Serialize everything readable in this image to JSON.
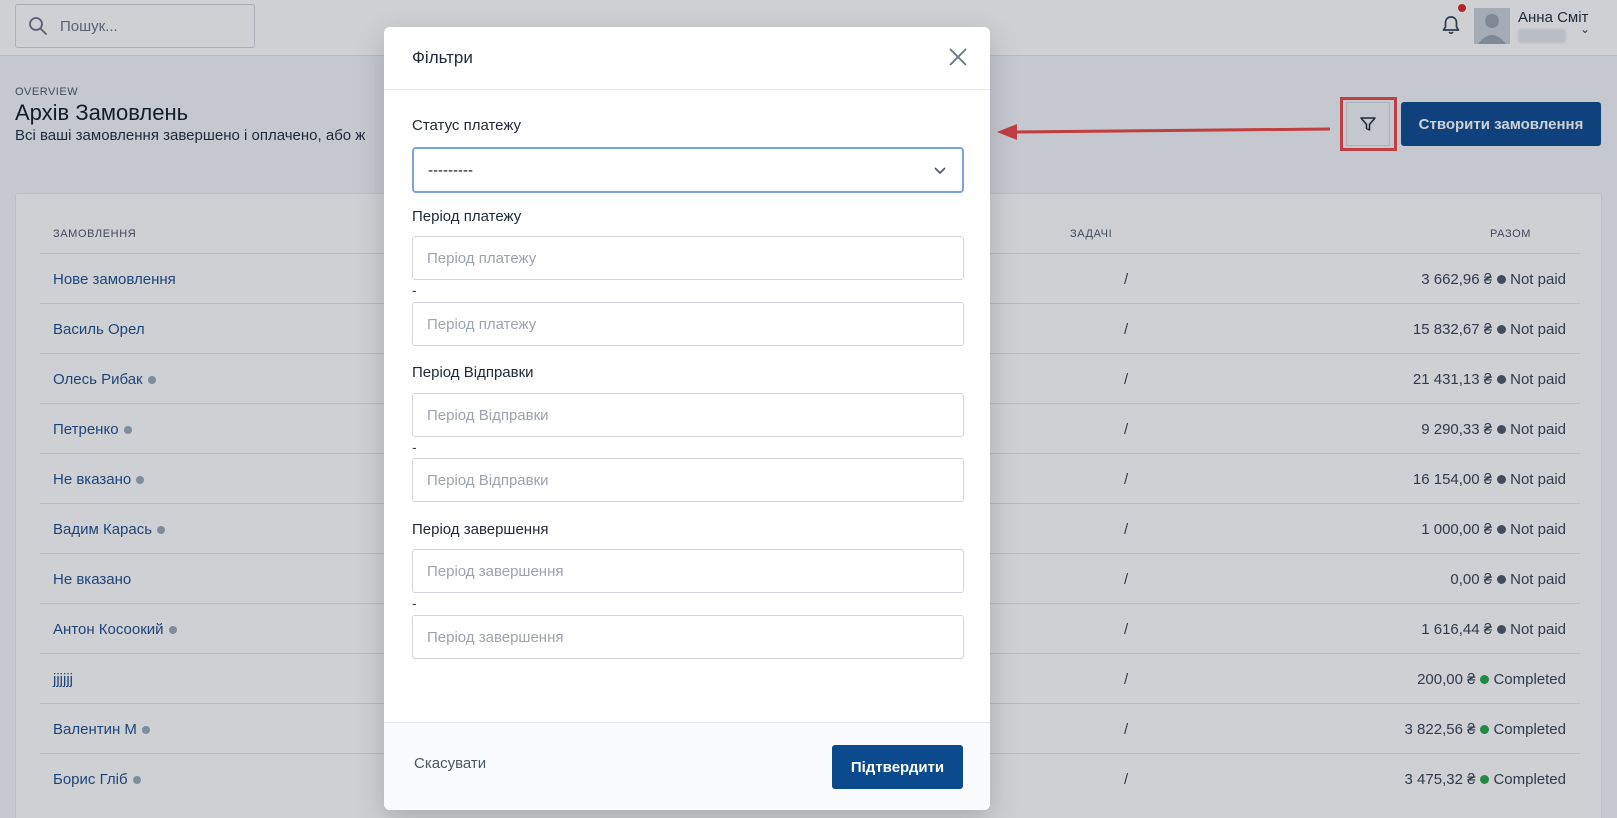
{
  "header": {
    "search_placeholder": "Пошук...",
    "user_name": "Анна Сміт"
  },
  "page": {
    "overline": "OVERVIEW",
    "title": "Архів Замовлень",
    "description": "Всі ваші замовлення завершено і оплачено, або ж",
    "create_button": "Створити замовлення"
  },
  "table": {
    "headers": {
      "orders": "ЗАМОВЛЕННЯ",
      "tasks": "ЗАДАЧІ",
      "total": "РАЗОМ"
    },
    "rows": [
      {
        "name": "Нове замовлення",
        "tasks": "/",
        "amount": "3 662,96 ₴",
        "status": "Not paid"
      },
      {
        "name": "Василь Орел",
        "tasks": "/",
        "amount": "15 832,67 ₴",
        "status": "Not paid"
      },
      {
        "name": "Олесь Рибак",
        "tasks": "/",
        "amount": "21 431,13 ₴",
        "status": "Not paid"
      },
      {
        "name": "Петренко",
        "tasks": "/",
        "amount": "9 290,33 ₴",
        "status": "Not paid"
      },
      {
        "name": "Не вказано",
        "tasks": "/",
        "amount": "16 154,00 ₴",
        "status": "Not paid"
      },
      {
        "name": "Вадим Карась",
        "tasks": "/",
        "amount": "1 000,00 ₴",
        "status": "Not paid"
      },
      {
        "name": "Не вказано",
        "tasks": "/",
        "amount": "0,00 ₴",
        "status": "Not paid"
      },
      {
        "name": "Антон Косоокий",
        "tasks": "/",
        "amount": "1 616,44 ₴",
        "status": "Not paid"
      },
      {
        "name": "jjjjjj",
        "tasks": "/",
        "amount": "200,00 ₴",
        "status": "Completed"
      },
      {
        "name": "Валентин М",
        "tasks": "/",
        "amount": "3 822,56 ₴",
        "status": "Completed"
      },
      {
        "name": "Борис Гліб",
        "tasks": "/",
        "amount": "3 475,32 ₴",
        "status": "Completed"
      }
    ]
  },
  "modal": {
    "title": "Фільтри",
    "payment_status_label": "Статус платежу",
    "payment_status_value": "---------",
    "payment_period_label": "Період платежу",
    "payment_period_placeholder": "Період платежу",
    "shipping_period_label": "Період Відправки",
    "shipping_period_placeholder": "Період Відправки",
    "completion_period_label": "Період завершення",
    "completion_period_placeholder": "Період завершення",
    "range_separator": "-",
    "cancel_label": "Скасувати",
    "confirm_label": "Підтвердити"
  },
  "colors": {
    "primary": "#0b4a8f",
    "link": "#1e4e8c",
    "not_paid_dot": "#4b5563",
    "completed_dot": "#22a447",
    "highlight": "#ef4444"
  }
}
